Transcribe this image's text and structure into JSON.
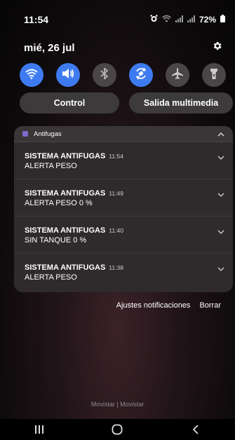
{
  "status_bar": {
    "time": "11:54",
    "battery": "72%",
    "icons": [
      "alarm-icon",
      "wifi-signal-icon",
      "cell-signal-icon",
      "cell-signal-icon",
      "battery-icon"
    ]
  },
  "header": {
    "date": "mié, 26 jul",
    "settings_icon": "gear-icon"
  },
  "quick_settings": [
    {
      "name": "wifi",
      "icon": "wifi-icon",
      "on": true
    },
    {
      "name": "sound",
      "icon": "sound-icon",
      "on": true
    },
    {
      "name": "bluetooth",
      "icon": "bluetooth-icon",
      "on": false
    },
    {
      "name": "autorotate",
      "icon": "autorotate-icon",
      "on": true
    },
    {
      "name": "airplane",
      "icon": "airplane-icon",
      "on": false
    },
    {
      "name": "flashlight",
      "icon": "flashlight-icon",
      "on": false
    }
  ],
  "pills": {
    "control": "Control",
    "media": "Salida multimedia"
  },
  "notifications": {
    "app_name": "Antifugas",
    "items": [
      {
        "title": "SISTEMA ANTIFUGAS",
        "time": "11:54",
        "body": "ALERTA PESO"
      },
      {
        "title": "SISTEMA ANTIFUGAS",
        "time": "11:49",
        "body": "ALERTA PESO 0 %"
      },
      {
        "title": "SISTEMA ANTIFUGAS",
        "time": "11:40",
        "body": "SIN TANQUE 0 %"
      },
      {
        "title": "SISTEMA ANTIFUGAS",
        "time": "11:38",
        "body": "ALERTA PESO"
      }
    ]
  },
  "actions": {
    "settings": "Ajustes notificaciones",
    "clear": "Borrar"
  },
  "carrier": "Movistar | Movistar",
  "navigation": [
    "recents-icon",
    "home-icon",
    "back-icon"
  ],
  "colors": {
    "accent": "#3e7bf1",
    "tile_off": "#4a4648",
    "panel": "#2f2b2d"
  }
}
